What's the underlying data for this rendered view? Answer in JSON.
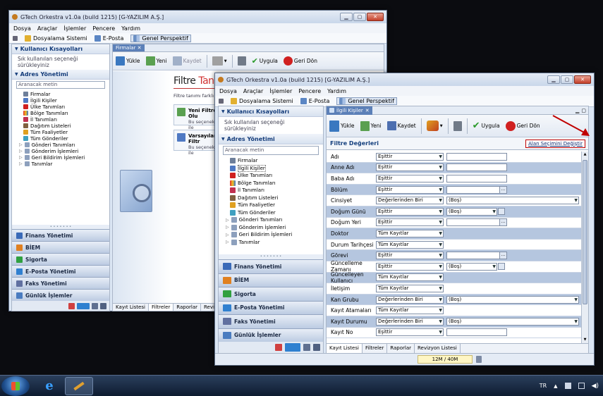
{
  "win1": {
    "title": "GTech Orkestra v1.0a (build 1215) [G-YAZILIM A.Ş.]",
    "menu": [
      "Dosya",
      "Araçlar",
      "İşlemler",
      "Pencere",
      "Yardım"
    ],
    "persp": [
      "Dosyalama Sistemi",
      "E-Posta",
      "Genel Perspektif"
    ],
    "left": {
      "shortcuts_title": "Kullanıcı Kısayolları",
      "shortcuts_sub": "Sık kullanılan seçeneği sürükleyiniz",
      "addr_title": "Adres Yönetimi",
      "search_ph": "Aranacak metin",
      "tree": [
        "Firmalar",
        "İlgili Kişiler",
        "Ülke Tanımları",
        "Bölge Tanımları",
        "İl Tanımları",
        "Dağıtım Listeleri",
        "Tüm Faaliyetler",
        "Tüm Gönderiler",
        "Gönderi Tanımları",
        "Gönderim İşlemleri",
        "Geri Bildirim İşlemleri",
        "Tanımlar"
      ],
      "accordion": [
        "Finans Yönetimi",
        "BİEM",
        "Sigorta",
        "E-Posta Yönetimi",
        "Faks Yönetimi",
        "Günlük İşlemler"
      ]
    },
    "tab": "Firmalar",
    "toolbar": [
      "Yükle",
      "Yeni",
      "Kaydet",
      "Uygula",
      "Geri Dön"
    ],
    "filtre_title_a": "Filtre ",
    "filtre_title_b": "Tanımı",
    "filtre_desc": "Filtre tanımı farklı yöntemle",
    "card1_title": "Yeni Filtre Olu",
    "card1_sub": "Bu seçenek ile",
    "card2_title": "Varsayılan Filtr",
    "card2_sub": "Bu seçenek ile",
    "bottomtabs": [
      "Kayıt Listesi",
      "Filtreler",
      "Raporlar",
      "Revizyon Listesi"
    ]
  },
  "win2": {
    "title": "GTech Orkestra v1.0a (build 1215) [G-YAZILIM A.Ş.]",
    "menu": [
      "Dosya",
      "Araçlar",
      "İşlemler",
      "Pencere",
      "Yardım"
    ],
    "persp": [
      "Dosyalama Sistemi",
      "E-Posta",
      "Genel Perspektif"
    ],
    "left": {
      "shortcuts_title": "Kullanıcı Kısayolları",
      "shortcuts_sub": "Sık kullanılan seçeneği sürükleyiniz",
      "addr_title": "Adres Yönetimi",
      "search_ph": "Aranacak metin",
      "tree": [
        "Firmalar",
        "İlgili Kişiler",
        "Ülke Tanımları",
        "Bölge Tanımları",
        "İl Tanımları",
        "Dağıtım Listeleri",
        "Tüm Faaliyetler",
        "Tüm Gönderiler",
        "Gönderi Tanımları",
        "Gönderim İşlemleri",
        "Geri Bildirim İşlemleri",
        "Tanımlar"
      ],
      "accordion": [
        "Finans Yönetimi",
        "BİEM",
        "Sigorta",
        "E-Posta Yönetimi",
        "Faks Yönetimi",
        "Günlük İşlemler"
      ]
    },
    "tab": "İlgili Kişiler",
    "toolbar": [
      "Yükle",
      "Yeni",
      "Kaydet",
      "Uygula",
      "Geri Dön"
    ],
    "filter_header": "Filtre Değerleri",
    "change_fields": "Alan Seçimini Değiştir",
    "rows": [
      {
        "label": "Adı",
        "op": "Eşittir",
        "type": "text",
        "value": ""
      },
      {
        "label": "Anne Adı",
        "op": "Eşittir",
        "type": "text",
        "value": ""
      },
      {
        "label": "Baba Adı",
        "op": "Eşittir",
        "type": "text",
        "value": ""
      },
      {
        "label": "Bölüm",
        "op": "Eşittir",
        "type": "lookup",
        "value": ""
      },
      {
        "label": "Cinsiyet",
        "op": "Değerlerinden Biri",
        "type": "select",
        "value": "(Boş)"
      },
      {
        "label": "Doğum Günü",
        "op": "Eşittir",
        "type": "date",
        "value": "(Boş)"
      },
      {
        "label": "Doğum Yeri",
        "op": "Eşittir",
        "type": "lookup",
        "value": ""
      },
      {
        "label": "Doktor",
        "op": "Tüm Kayıtlar",
        "type": "none",
        "value": ""
      },
      {
        "label": "Durum Tarihçesi",
        "op": "Tüm Kayıtlar",
        "type": "none",
        "value": ""
      },
      {
        "label": "Görevi",
        "op": "Eşittir",
        "type": "lookup",
        "value": ""
      },
      {
        "label": "Güncelleme Zamanı",
        "op": "Eşittir",
        "type": "date",
        "value": "(Boş)"
      },
      {
        "label": "Güncelleyen Kullanıcı",
        "op": "Tüm Kayıtlar",
        "type": "none",
        "value": ""
      },
      {
        "label": "İletişim",
        "op": "Tüm Kayıtlar",
        "type": "none",
        "value": ""
      },
      {
        "label": "Kan Grubu",
        "op": "Değerlerinden Biri",
        "type": "select",
        "value": "(Boş)"
      },
      {
        "label": "Kayıt Atamaları",
        "op": "Tüm Kayıtlar",
        "type": "none",
        "value": ""
      },
      {
        "label": "Kayıt Durumu",
        "op": "Değerlerinden Biri",
        "type": "select",
        "value": "(Boş)"
      },
      {
        "label": "Kayıt No",
        "op": "Eşittir",
        "type": "text",
        "value": ""
      }
    ],
    "bottomtabs": [
      "Kayıt Listesi",
      "Filtreler",
      "Raporlar",
      "Revizyon Listesi"
    ],
    "memory": "12M / 40M"
  },
  "taskbar": {
    "lang": "TR"
  },
  "colors": {
    "highlight": "#c00000",
    "rowAlt": "#b5c6df"
  }
}
